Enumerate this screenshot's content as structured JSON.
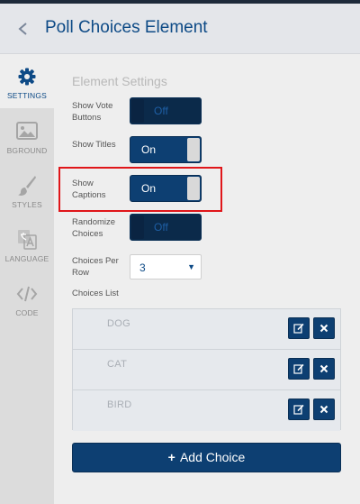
{
  "header": {
    "title": "Poll Choices Element",
    "back_icon": "chevron-left-icon"
  },
  "sidebar": {
    "items": [
      {
        "label": "SETTINGS",
        "icon": "gear-icon",
        "active": true
      },
      {
        "label": "BGROUND",
        "icon": "image-icon",
        "active": false
      },
      {
        "label": "STYLES",
        "icon": "paintbrush-icon",
        "active": false
      },
      {
        "label": "LANGUAGE",
        "icon": "translate-icon",
        "active": false
      },
      {
        "label": "CODE",
        "icon": "code-icon",
        "active": false
      }
    ]
  },
  "settings": {
    "section_title": "Element Settings",
    "show_vote_buttons": {
      "label": "Show Vote Buttons",
      "state": "Off"
    },
    "show_titles": {
      "label": "Show Titles",
      "state": "On"
    },
    "show_captions": {
      "label": "Show Captions",
      "state": "On"
    },
    "randomize_choices": {
      "label": "Randomize Choices",
      "state": "Off"
    },
    "choices_per_row": {
      "label": "Choices Per Row",
      "value": "3"
    }
  },
  "choices": {
    "label": "Choices List",
    "items": [
      "DOG",
      "CAT",
      "BIRD"
    ],
    "add_label": "Add Choice"
  },
  "colors": {
    "accent": "#0d4a86",
    "button": "#0d3f72",
    "highlight": "#e0161a"
  }
}
